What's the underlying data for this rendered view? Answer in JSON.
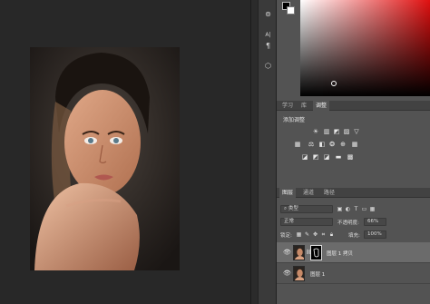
{
  "toolbar": {
    "tools": [
      {
        "name": "history-brush-icon",
        "glyph": "⊚"
      },
      {
        "name": "character-icon",
        "glyph": "A|"
      },
      {
        "name": "paragraph-icon",
        "glyph": "¶"
      },
      {
        "name": "cube-3d-icon",
        "glyph": "⬡"
      }
    ]
  },
  "colors": {
    "foreground": "#000000",
    "background": "#ffffff",
    "hue": "#e01010"
  },
  "adjust_panel": {
    "tabs": [
      "学习",
      "库",
      "调整"
    ],
    "active_tab": "调整",
    "title": "添加调整",
    "rows": [
      [
        "☀",
        "▥",
        "◩",
        "▨",
        "▽"
      ],
      [
        "▦",
        "⚖",
        "◧",
        "❂",
        "⊕",
        "▦"
      ],
      [
        "◪",
        "◩",
        "◪",
        "▬",
        "▩"
      ]
    ]
  },
  "layers_panel": {
    "tabs": [
      "图层",
      "通道",
      "路径"
    ],
    "active_tab": "图层",
    "filter": {
      "kind_label": "类型",
      "icons": [
        "image-filter-icon",
        "adjustment-filter-icon",
        "type-filter-icon",
        "shape-filter-icon",
        "smart-object-filter-icon"
      ]
    },
    "blend_mode": "正常",
    "opacity_label": "不透明度:",
    "opacity_value": "66%",
    "lock_label": "锁定:",
    "fill_label": "填充:",
    "fill_value": "100%",
    "layers": [
      {
        "name": "图层 1 拷贝",
        "selected": true,
        "has_mask": true
      },
      {
        "name": "图层 1",
        "selected": false,
        "has_mask": false
      }
    ]
  }
}
